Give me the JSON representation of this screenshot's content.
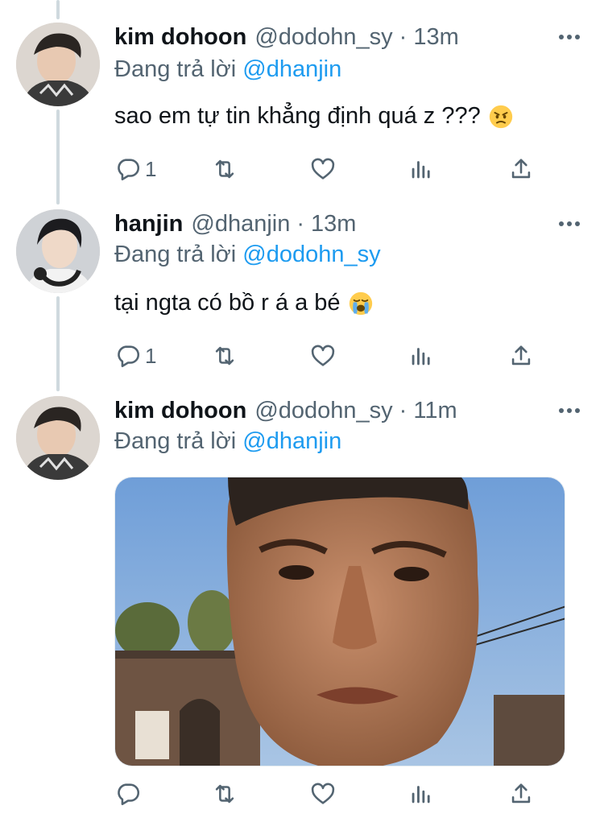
{
  "tweets": [
    {
      "name": "kim dohoon",
      "handle": "@dodohn_sy",
      "separator": "·",
      "time": "13m",
      "replying_prefix": "Đang trả lời",
      "replying_to": "@dhanjin",
      "text": "sao em tự tin khẳng định quá z ???",
      "emoji": "angry-face-icon",
      "reply_count": "1"
    },
    {
      "name": "hanjin",
      "handle": "@dhanjin",
      "separator": "·",
      "time": "13m",
      "replying_prefix": "Đang trả lời",
      "replying_to": "@dodohn_sy",
      "text": "tại ngta có bồ r á a bé",
      "emoji": "crying-face-icon",
      "reply_count": "1"
    },
    {
      "name": "kim dohoon",
      "handle": "@dodohn_sy",
      "separator": "·",
      "time": "11m",
      "replying_prefix": "Đang trả lời",
      "replying_to": "@dhanjin",
      "media": "frowning-man-meme-photo",
      "reply_count": ""
    }
  ],
  "icons": [
    "reply-icon",
    "retweet-icon",
    "like-icon",
    "analytics-icon",
    "share-icon",
    "more-icon"
  ],
  "colors": {
    "link": "#1d9bf0",
    "secondary": "#536471",
    "thread_line": "#cfd9de"
  }
}
